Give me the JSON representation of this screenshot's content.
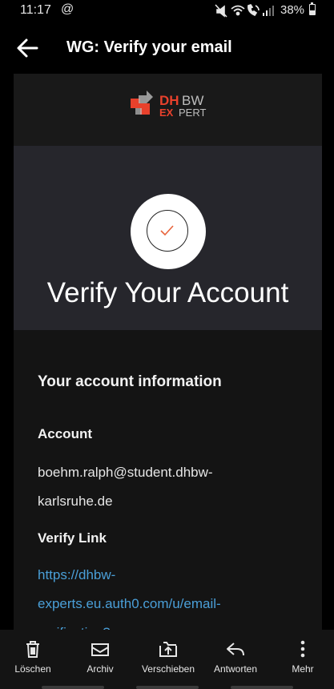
{
  "status_bar": {
    "time": "11:17",
    "at_icon": "@",
    "icons": [
      "mute-icon",
      "wifi-icon",
      "wifi-call-icon",
      "signal-icon"
    ],
    "battery_percent_text": "38%",
    "battery_level": 0.38
  },
  "header": {
    "back_icon": "arrow-left-icon",
    "title": "WG: Verify your email"
  },
  "email": {
    "logo": {
      "dh": "DH",
      "bw": "BW",
      "ex": "EX",
      "pert": "PERT"
    },
    "hero_title": "Verify Your Account",
    "section_title": "Your account information",
    "account_label": "Account",
    "account_line1": "boehm.ralph@student.dhbw-",
    "account_line2": "karlsruhe.de",
    "verify_label": "Verify Link",
    "link_line1": "https://dhbw-",
    "link_line2": "experts.eu.auth0.com/u/email-",
    "link_line3": "verification?"
  },
  "colors": {
    "accent_link": "#4a9fd8",
    "logo_red": "#e8412c",
    "check_orange": "#e8643c"
  },
  "toolbar": [
    {
      "label": "Löschen",
      "icon": "trash-icon"
    },
    {
      "label": "Archiv",
      "icon": "archive-icon"
    },
    {
      "label": "Verschieben",
      "icon": "move-icon"
    },
    {
      "label": "Antworten",
      "icon": "reply-icon"
    },
    {
      "label": "Mehr",
      "icon": "more-vertical-icon"
    }
  ]
}
